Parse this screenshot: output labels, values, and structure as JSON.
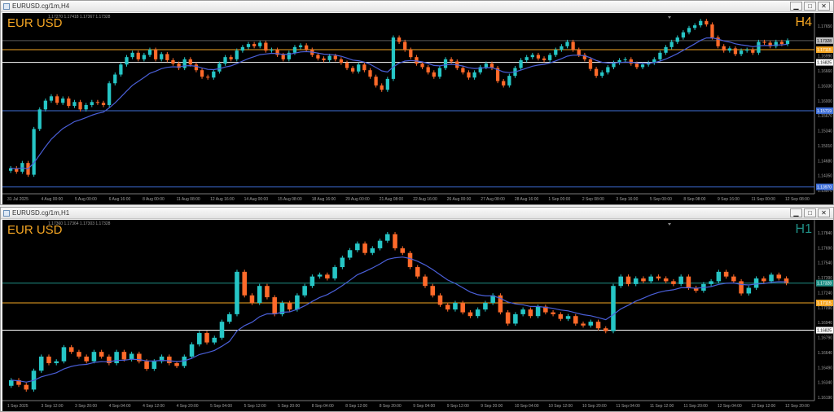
{
  "windows": [
    {
      "title": "EURUSD.cg/1m,H4",
      "symbol": "EUR USD",
      "timeframe": "H4",
      "ohlc_partial": "1.17270 1.17418 1.17367 1.17328",
      "colors": {
        "symbol": "#f5a623",
        "timeframe": "#f5a623"
      },
      "buttons": [
        "minimize",
        "maximize",
        "close"
      ],
      "chart_data": {
        "type": "candlestick",
        "price_ticks": [
          "1.17650",
          "1.17320",
          "1.16990",
          "1.16660",
          "1.16330",
          "1.16000",
          "1.15670",
          "1.15340",
          "1.15010",
          "1.14680",
          "1.14350",
          "1.13970"
        ],
        "time_ticks": [
          "31 Jul 2025",
          "4 Aug 00:00",
          "5 Aug 00:00",
          "6 Aug 16:00",
          "8 Aug 00:00",
          "11 Aug 08:00",
          "12 Aug 16:00",
          "14 Aug 00:00",
          "15 Aug 08:00",
          "18 Aug 16:00",
          "20 Aug 00:00",
          "21 Aug 08:00",
          "22 Aug 16:00",
          "26 Aug 00:00",
          "27 Aug 08:00",
          "28 Aug 16:00",
          "1 Sep 00:00",
          "2 Sep 08:00",
          "3 Sep 16:00",
          "5 Sep 00:00",
          "8 Sep 08:00",
          "9 Sep 16:00",
          "11 Sep 00:00",
          "12 Sep 08:00"
        ],
        "price_labels": [
          {
            "value": "1.17328",
            "kind": "current"
          },
          {
            "value": "1.17115",
            "kind": "orange"
          },
          {
            "value": "1.16825",
            "kind": "white"
          },
          {
            "value": "1.15719",
            "kind": "blue"
          },
          {
            "value": "1.13970",
            "kind": "blue"
          }
        ],
        "levels": [
          {
            "price": 1.1733,
            "color": "#5a5a5a"
          },
          {
            "price": 1.1712,
            "color": "#f5a623"
          },
          {
            "price": 1.1683,
            "color": "#ffffff"
          },
          {
            "price": 1.1572,
            "color": "#3f6fd8"
          },
          {
            "price": 1.1397,
            "color": "#3f6fd8"
          }
        ],
        "y_range": [
          1.1385,
          1.1785
        ],
        "candles_close": [
          1.144,
          1.1432,
          1.1452,
          1.1425,
          1.153,
          1.1575,
          1.1595,
          1.1605,
          1.159,
          1.16,
          1.1583,
          1.1592,
          1.1575,
          1.1585,
          1.1592,
          1.159,
          1.1585,
          1.1635,
          1.1655,
          1.1678,
          1.1695,
          1.1705,
          1.169,
          1.17,
          1.1712,
          1.169,
          1.1702,
          1.1688,
          1.168,
          1.167,
          1.169,
          1.1678,
          1.1665,
          1.165,
          1.1648,
          1.1662,
          1.168,
          1.1695,
          1.169,
          1.171,
          1.1718,
          1.1725,
          1.172,
          1.1728,
          1.171,
          1.1712,
          1.17,
          1.169,
          1.1705,
          1.1718,
          1.1722,
          1.1712,
          1.17,
          1.1692,
          1.1688,
          1.1698,
          1.169,
          1.1682,
          1.167,
          1.1662,
          1.1678,
          1.1665,
          1.165,
          1.163,
          1.162,
          1.1645,
          1.174,
          1.173,
          1.1712,
          1.1695,
          1.168,
          1.1672,
          1.166,
          1.165,
          1.167,
          1.169,
          1.1685,
          1.167,
          1.166,
          1.1648,
          1.166,
          1.1672,
          1.168,
          1.167,
          1.164,
          1.163,
          1.1652,
          1.167,
          1.1688,
          1.1695,
          1.17,
          1.1692,
          1.1688,
          1.17,
          1.1712,
          1.172,
          1.173,
          1.1712,
          1.17,
          1.169,
          1.1668,
          1.1652,
          1.166,
          1.1672,
          1.1682,
          1.1688,
          1.169,
          1.168,
          1.1672,
          1.1678,
          1.1682,
          1.169,
          1.1705,
          1.1718,
          1.173,
          1.174,
          1.1752,
          1.1762,
          1.1768,
          1.1778,
          1.177,
          1.174,
          1.172,
          1.171,
          1.1715,
          1.1702,
          1.171,
          1.1712,
          1.1705,
          1.173,
          1.1728,
          1.172,
          1.173,
          1.1725,
          1.1733
        ],
        "ma_color": "#4a5fd8"
      }
    },
    {
      "title": "EURUSD.cg/1m,H1",
      "symbol": "EUR USD",
      "timeframe": "H1",
      "ohlc_partial": "1.17360 1.17364 1.17303 1.17328",
      "colors": {
        "symbol": "#f5a623",
        "timeframe": "#1f8f86"
      },
      "buttons": [
        "minimize",
        "maximize",
        "close"
      ],
      "chart_data": {
        "type": "candlestick",
        "price_ticks": [
          "1.17840",
          "1.17690",
          "1.17540",
          "1.17390",
          "1.17240",
          "1.17090",
          "1.16940",
          "1.16790",
          "1.16640",
          "1.16490",
          "1.16340",
          "1.16190"
        ],
        "time_ticks": [
          "1 Sep 2025",
          "3 Sep 12:00",
          "3 Sep 20:00",
          "4 Sep 04:00",
          "4 Sep 12:00",
          "4 Sep 20:00",
          "5 Sep 04:00",
          "5 Sep 12:00",
          "5 Sep 20:00",
          "8 Sep 04:00",
          "8 Sep 12:00",
          "8 Sep 20:00",
          "9 Sep 04:00",
          "9 Sep 12:00",
          "9 Sep 20:00",
          "10 Sep 04:00",
          "10 Sep 12:00",
          "10 Sep 20:00",
          "11 Sep 04:00",
          "11 Sep 12:00",
          "11 Sep 20:00",
          "12 Sep 04:00",
          "12 Sep 12:00",
          "12 Sep 20:00"
        ],
        "price_labels": [
          {
            "value": "1.17328",
            "kind": "teal"
          },
          {
            "value": "1.17115",
            "kind": "orange"
          },
          {
            "value": "1.16825",
            "kind": "white"
          }
        ],
        "levels": [
          {
            "price": 1.1733,
            "color": "#1f8f86"
          },
          {
            "price": 1.1712,
            "color": "#f5a623"
          },
          {
            "price": 1.1683,
            "color": "#ffffff"
          }
        ],
        "y_range": [
          1.161,
          1.1795
        ],
        "candles_close": [
          1.163,
          1.1625,
          1.162,
          1.164,
          1.1655,
          1.1648,
          1.165,
          1.1665,
          1.166,
          1.1655,
          1.165,
          1.166,
          1.1655,
          1.1648,
          1.166,
          1.1652,
          1.1658,
          1.165,
          1.1642,
          1.165,
          1.1655,
          1.1648,
          1.1645,
          1.1655,
          1.1668,
          1.168,
          1.167,
          1.1675,
          1.1692,
          1.17,
          1.1745,
          1.172,
          1.1712,
          1.173,
          1.1718,
          1.17,
          1.1712,
          1.1705,
          1.172,
          1.173,
          1.174,
          1.1742,
          1.1738,
          1.175,
          1.176,
          1.1768,
          1.1775,
          1.1765,
          1.177,
          1.1778,
          1.1785,
          1.177,
          1.1765,
          1.175,
          1.174,
          1.173,
          1.172,
          1.171,
          1.1705,
          1.1712,
          1.1702,
          1.1698,
          1.1705,
          1.1712,
          1.172,
          1.1702,
          1.169,
          1.17,
          1.1705,
          1.1698,
          1.1708,
          1.1702,
          1.17,
          1.1695,
          1.1698,
          1.169,
          1.1688,
          1.1692,
          1.1685,
          1.1682,
          1.173,
          1.174,
          1.1732,
          1.1738,
          1.1735,
          1.174,
          1.1738,
          1.1735,
          1.1732,
          1.174,
          1.1728,
          1.1725,
          1.1732,
          1.1735,
          1.1745,
          1.174,
          1.1735,
          1.1722,
          1.1728,
          1.1738,
          1.1735,
          1.1742,
          1.1738,
          1.1733
        ],
        "ma_color": "#4a5fd8"
      }
    }
  ]
}
